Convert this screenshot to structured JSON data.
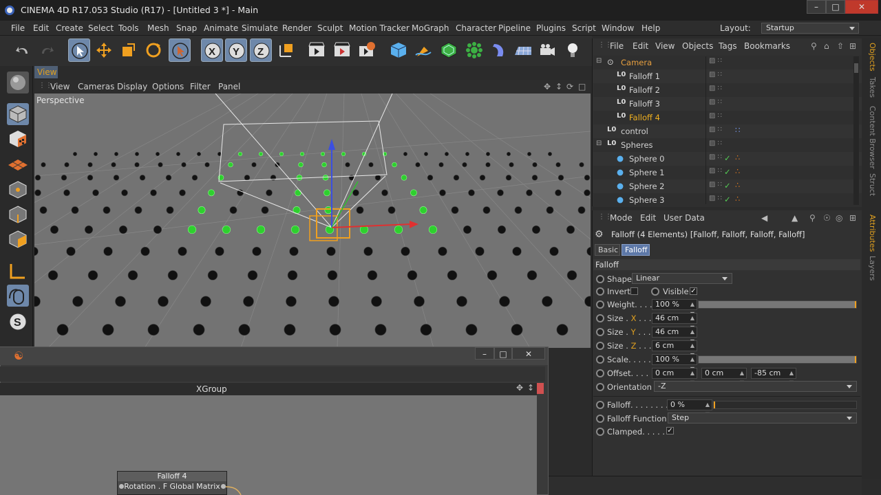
{
  "window": {
    "title": "CINEMA 4D R17.053 Studio (R17) - [Untitled 3 *] - Main"
  },
  "menubar": {
    "items": [
      "File",
      "Edit",
      "Create",
      "Select",
      "Tools",
      "Mesh",
      "Snap",
      "Animate",
      "Simulate",
      "Render",
      "Sculpt",
      "Motion Tracker",
      "MoGraph",
      "Character",
      "Pipeline",
      "Plugins",
      "Script",
      "Window",
      "Help"
    ],
    "layout_label": "Layout:",
    "layout_value": "Startup"
  },
  "viewport": {
    "tab": "View",
    "menu": [
      "View",
      "Cameras",
      "Display",
      "Options",
      "Filter",
      "Panel"
    ],
    "label": "Perspective"
  },
  "object_manager": {
    "menu": [
      "File",
      "Edit",
      "View",
      "Objects",
      "Tags",
      "Bookmarks"
    ],
    "rows": [
      {
        "name": "Camera",
        "kind": "camera",
        "indent": 0
      },
      {
        "name": "Falloff 1",
        "kind": "null",
        "indent": 1
      },
      {
        "name": "Falloff 2",
        "kind": "null",
        "indent": 1
      },
      {
        "name": "Falloff 3",
        "kind": "null",
        "indent": 1
      },
      {
        "name": "Falloff 4",
        "kind": "null",
        "indent": 1,
        "highlight": true
      },
      {
        "name": "control",
        "kind": "null",
        "indent": 0
      },
      {
        "name": "Spheres",
        "kind": "null",
        "indent": 0
      },
      {
        "name": "Sphere 0",
        "kind": "sphere",
        "indent": 1
      },
      {
        "name": "Sphere 1",
        "kind": "sphere",
        "indent": 1
      },
      {
        "name": "Sphere 2",
        "kind": "sphere",
        "indent": 1
      },
      {
        "name": "Sphere 3",
        "kind": "sphere",
        "indent": 1
      }
    ]
  },
  "side_tabs": {
    "top": [
      "Objects",
      "Takes",
      "Content Browser",
      "Struct"
    ],
    "bottom": [
      "Attributes",
      "Layers"
    ]
  },
  "attributes": {
    "menu": [
      "Mode",
      "Edit",
      "User Data"
    ],
    "header": "Falloff (4 Elements) [Falloff, Falloff, Falloff, Falloff]",
    "tabs": [
      "Basic",
      "Falloff"
    ],
    "section": "Falloff",
    "shape_label": "Shape",
    "shape_value": "Linear",
    "invert_label": "Invert",
    "visible_label": "Visible",
    "weight_label": "Weight. . . .",
    "weight_value": "100 %",
    "size_label": "Size .",
    "size_x": "X",
    "size_y": "Y",
    "size_z": "Z",
    "size_dots": " . . . .",
    "size_x_value": "46 cm",
    "size_y_value": "46 cm",
    "size_z_value": "6 cm",
    "scale_label": "Scale. . . . . .",
    "scale_value": "100 %",
    "offset_label": "Offset. . . .",
    "offset_x": "0 cm",
    "offset_y": "0 cm",
    "offset_z": "-85 cm",
    "orientation_label": "Orientation",
    "orientation_value": "-Z",
    "falloff_label": "Falloff. . . . . . . .",
    "falloff_value": "0 %",
    "falloff_function_label": "Falloff Function",
    "falloff_function_value": "Step",
    "clamped_label": "Clamped. . . . ."
  },
  "xpresso": {
    "group_name": "XGroup",
    "node_title": "Falloff 4",
    "node_port": "Rotation . F Global Matrix"
  }
}
